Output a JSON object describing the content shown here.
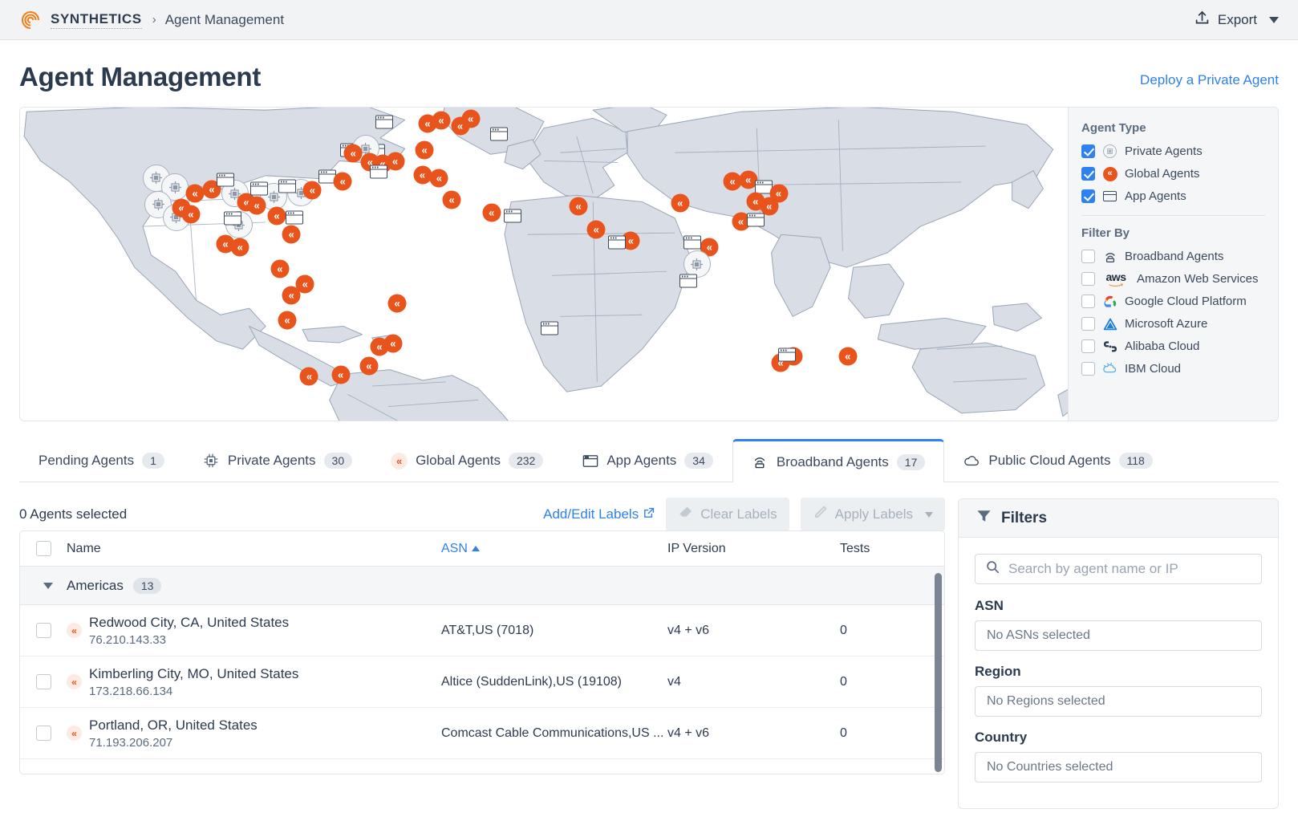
{
  "topbar": {
    "brand": "SYNTHETICS",
    "separator": "›",
    "breadcrumb_current": "Agent Management",
    "export_label": "Export"
  },
  "page": {
    "title": "Agent Management",
    "deploy_link": "Deploy a Private Agent"
  },
  "map_legend": {
    "agent_type_heading": "Agent Type",
    "agent_types": [
      {
        "label": "Private Agents",
        "checked": true,
        "icon": "private-agent-icon"
      },
      {
        "label": "Global Agents",
        "checked": true,
        "icon": "global-agent-icon"
      },
      {
        "label": "App Agents",
        "checked": true,
        "icon": "app-agent-icon"
      }
    ],
    "filter_by_heading": "Filter By",
    "filter_by": [
      {
        "label": "Broadband Agents",
        "checked": false,
        "icon": "broadband-icon"
      },
      {
        "label": "Amazon Web Services",
        "checked": false,
        "icon": "aws-icon"
      },
      {
        "label": "Google Cloud Platform",
        "checked": false,
        "icon": "gcp-icon"
      },
      {
        "label": "Microsoft Azure",
        "checked": false,
        "icon": "azure-icon"
      },
      {
        "label": "Alibaba Cloud",
        "checked": false,
        "icon": "alibaba-icon"
      },
      {
        "label": "IBM Cloud",
        "checked": false,
        "icon": "ibm-icon"
      }
    ]
  },
  "tabs": [
    {
      "label": "Pending Agents",
      "count": "1",
      "icon": "none",
      "active": false
    },
    {
      "label": "Private Agents",
      "count": "30",
      "icon": "chip-icon",
      "active": false
    },
    {
      "label": "Global Agents",
      "count": "232",
      "icon": "global-agent-icon",
      "active": false
    },
    {
      "label": "App Agents",
      "count": "34",
      "icon": "window-icon",
      "active": false
    },
    {
      "label": "Broadband Agents",
      "count": "17",
      "icon": "wifi-router-icon",
      "active": true
    },
    {
      "label": "Public Cloud Agents",
      "count": "118",
      "icon": "cloud-icon",
      "active": false
    }
  ],
  "toolbar": {
    "selection_text": "0 Agents selected",
    "add_edit_labels": "Add/Edit Labels",
    "clear_labels": "Clear Labels",
    "apply_labels": "Apply Labels"
  },
  "table": {
    "columns": [
      "Name",
      "ASN",
      "IP Version",
      "Tests"
    ],
    "sorted_column": "ASN",
    "sort_direction": "asc",
    "group": {
      "name": "Americas",
      "count": "13",
      "expanded": true
    },
    "rows": [
      {
        "name": "Redwood City, CA, United States",
        "ip": "76.210.143.33",
        "asn": "AT&T,US (7018)",
        "ip_version": "v4 + v6",
        "tests": "0"
      },
      {
        "name": "Kimberling City, MO, United States",
        "ip": "173.218.66.134",
        "asn": "Altice (SuddenLink),US (19108)",
        "ip_version": "v4",
        "tests": "0"
      },
      {
        "name": "Portland, OR, United States",
        "ip": "71.193.206.207",
        "asn": "Comcast Cable Communications,US ...",
        "ip_version": "v4 + v6",
        "tests": "0"
      }
    ]
  },
  "filters": {
    "title": "Filters",
    "search_placeholder": "Search by agent name or IP",
    "groups": [
      {
        "label": "ASN",
        "value": "No ASNs selected"
      },
      {
        "label": "Region",
        "value": "No Regions selected"
      },
      {
        "label": "Country",
        "value": "No Countries selected"
      }
    ]
  },
  "colors": {
    "accent_blue": "#2f80f0",
    "brand_orange": "#e8541c",
    "text_dark": "#2d3b4e",
    "panel_gray": "#f4f6f8",
    "map_land": "#d9dee6"
  }
}
